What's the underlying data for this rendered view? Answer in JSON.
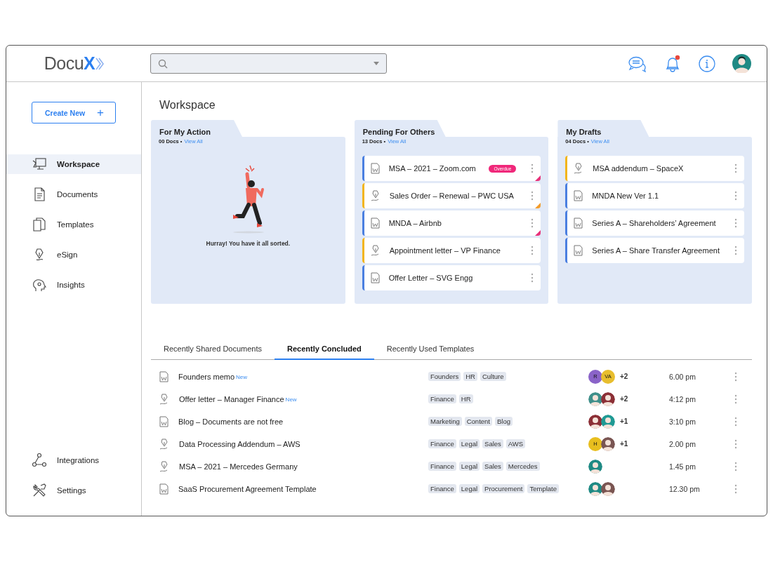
{
  "logo": {
    "name": "Docu",
    "mark": "X"
  },
  "header": {
    "notification": true,
    "avatar": {
      "kind": "person",
      "color": "#1f8a84"
    }
  },
  "create_button": {
    "label": "Create New",
    "icon": "+"
  },
  "sidebar": {
    "items": [
      {
        "label": "Workspace",
        "selected": true
      },
      {
        "label": "Documents",
        "selected": false
      },
      {
        "label": "Templates",
        "selected": false
      },
      {
        "label": "eSign",
        "selected": false
      },
      {
        "label": "Insights",
        "selected": false
      }
    ],
    "bottom_items": [
      {
        "label": "Integrations",
        "selected": false
      },
      {
        "label": "Settings",
        "selected": false
      }
    ]
  },
  "page_title": "Workspace",
  "folders": [
    {
      "title": "For My Action",
      "count": "00 Docs •",
      "link": "View All",
      "empty_message": "Hurray! You have it all sorted."
    },
    {
      "title": "Pending For Others",
      "count": "13 Docs •",
      "link": "View All",
      "items": [
        {
          "name": "MSA – 2021 – Zoom.com",
          "kind": "doc",
          "color": "#4a7fe0",
          "badge": "Overdue",
          "flag": {
            "color": "#e8317a"
          }
        },
        {
          "name": "Sales Order – Renewal – PWC USA",
          "kind": "sign",
          "color": "#f2b51b",
          "flag": {
            "color": "#f39c2c"
          }
        },
        {
          "name": "MNDA – Airbnb",
          "kind": "doc",
          "color": "#4a7fe0",
          "flag": {
            "color": "#e8317a"
          }
        },
        {
          "name": "Appointment letter – VP Finance",
          "kind": "sign",
          "color": "#f2b51b"
        },
        {
          "name": "Offer Letter – SVG Engg",
          "kind": "doc",
          "color": "#4a7fe0"
        }
      ]
    },
    {
      "title": "My Drafts",
      "count": "04 Docs •",
      "link": "View All",
      "items": [
        {
          "name": "MSA addendum – SpaceX",
          "kind": "sign",
          "color": "#f2b51b"
        },
        {
          "name": "MNDA New Ver 1.1",
          "kind": "doc",
          "color": "#4a7fe0"
        },
        {
          "name": "Series A – Shareholders’ Agreement",
          "kind": "doc",
          "color": "#4a7fe0"
        },
        {
          "name": "Series A – Share Transfer Agreement",
          "kind": "doc",
          "color": "#4a7fe0"
        }
      ]
    }
  ],
  "tabs": [
    {
      "label": "Recently Shared Documents",
      "selected": false
    },
    {
      "label": "Recently Concluded",
      "selected": true
    },
    {
      "label": "Recently Used Templates",
      "selected": false
    }
  ],
  "rows": [
    {
      "name": "Founders memo",
      "kind": "doc",
      "badge": "New",
      "tags": [
        "Founders",
        "HR",
        "Culture"
      ],
      "avatars": [
        {
          "kind": "initials",
          "text": "R",
          "color": "#8a63c8"
        },
        {
          "kind": "initials",
          "text": "VA",
          "color": "#e8be2e"
        }
      ],
      "extra": "+2",
      "time": "6.00 pm"
    },
    {
      "name": "Offer letter – Manager Finance",
      "kind": "sign",
      "badge": "New",
      "tags": [
        "Finance",
        "HR"
      ],
      "avatars": [
        {
          "kind": "person",
          "color": "#3f8f8a"
        },
        {
          "kind": "person",
          "color": "#8c2f36"
        }
      ],
      "extra": "+2",
      "time": "4:12 pm"
    },
    {
      "name": "Blog – Documents are not free",
      "kind": "doc",
      "tags": [
        "Marketing",
        "Content",
        "Blog"
      ],
      "avatars": [
        {
          "kind": "person",
          "color": "#8c2f36"
        },
        {
          "kind": "person",
          "color": "#1f9a94"
        }
      ],
      "extra": "+1",
      "time": "3:10 pm"
    },
    {
      "name": "Data Processing Addendum – AWS",
      "kind": "sign",
      "tags": [
        "Finance",
        "Legal",
        "Sales",
        "AWS"
      ],
      "avatars": [
        {
          "kind": "initials",
          "text": "H",
          "color": "#e8be1e"
        },
        {
          "kind": "person",
          "color": "#7a5552"
        }
      ],
      "extra": "+1",
      "time": "2.00 pm"
    },
    {
      "name": "MSA – 2021 – Mercedes Germany",
      "kind": "sign",
      "tags": [
        "Finance",
        "Legal",
        "Sales",
        "Mercedes"
      ],
      "avatars": [
        {
          "kind": "person",
          "color": "#1f8a84"
        }
      ],
      "time": "1.45 pm"
    },
    {
      "name": "SaaS Procurement Agreement Template",
      "kind": "doc",
      "tags": [
        "Finance",
        "Legal",
        "Procurement",
        "Template"
      ],
      "avatars": [
        {
          "kind": "person",
          "color": "#1f8a84"
        },
        {
          "kind": "person",
          "color": "#7a5552"
        }
      ],
      "time": "12.30 pm"
    }
  ]
}
